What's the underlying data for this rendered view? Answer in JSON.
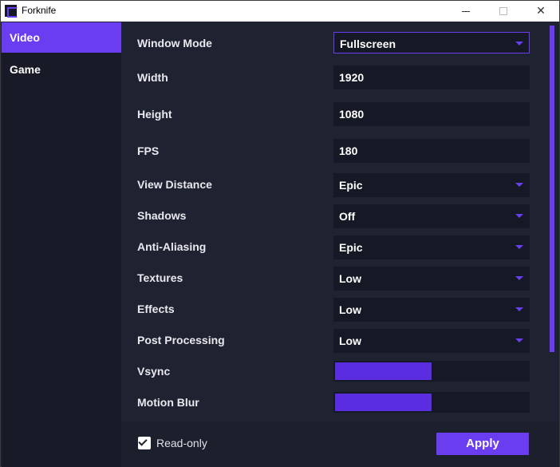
{
  "window": {
    "title": "Forknife",
    "icon": "forknife-app-icon",
    "controls": {
      "minimize_icon": "minimize-icon",
      "maximize_icon": "maximize-icon",
      "close_glyph": "✕"
    }
  },
  "sidebar": {
    "items": [
      {
        "label": "Video",
        "active": true
      },
      {
        "label": "Game",
        "active": false
      }
    ]
  },
  "settings": {
    "window_mode": {
      "label": "Window Mode",
      "value": "Fullscreen"
    },
    "width": {
      "label": "Width",
      "value": "1920"
    },
    "height": {
      "label": "Height",
      "value": "1080"
    },
    "fps": {
      "label": "FPS",
      "value": "180"
    },
    "view_distance": {
      "label": "View Distance",
      "value": "Epic"
    },
    "shadows": {
      "label": "Shadows",
      "value": "Off"
    },
    "anti_aliasing": {
      "label": "Anti-Aliasing",
      "value": "Epic"
    },
    "textures": {
      "label": "Textures",
      "value": "Low"
    },
    "effects": {
      "label": "Effects",
      "value": "Low"
    },
    "post_processing": {
      "label": "Post Processing",
      "value": "Low"
    },
    "vsync": {
      "label": "Vsync",
      "fill_fraction": 0.5
    },
    "motion_blur": {
      "label": "Motion Blur",
      "fill_fraction": 0.5
    }
  },
  "footer": {
    "readonly_label": "Read-only",
    "readonly_checked": true,
    "apply_label": "Apply"
  },
  "colors": {
    "accent": "#6a3df0",
    "background": "#1f2230",
    "sidebar": "#181a27",
    "field": "#151825"
  }
}
